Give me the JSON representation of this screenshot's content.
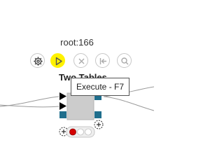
{
  "node": {
    "id_label": "root:166",
    "title": "Two Tables",
    "status": "not-configured"
  },
  "actions": {
    "configure": {
      "icon": "gear-icon"
    },
    "execute": {
      "icon": "play-icon",
      "highlight_color": "#fff200"
    },
    "cancel": {
      "icon": "cancel-icon"
    },
    "reset": {
      "icon": "reset-icon"
    },
    "view": {
      "icon": "view-icon"
    }
  },
  "tooltip": {
    "text": "Execute - F7"
  },
  "colors": {
    "data_port": "#000000",
    "table_port": "#1f6e8c",
    "node_body": "#cccccc",
    "status_error": "#d40000"
  }
}
